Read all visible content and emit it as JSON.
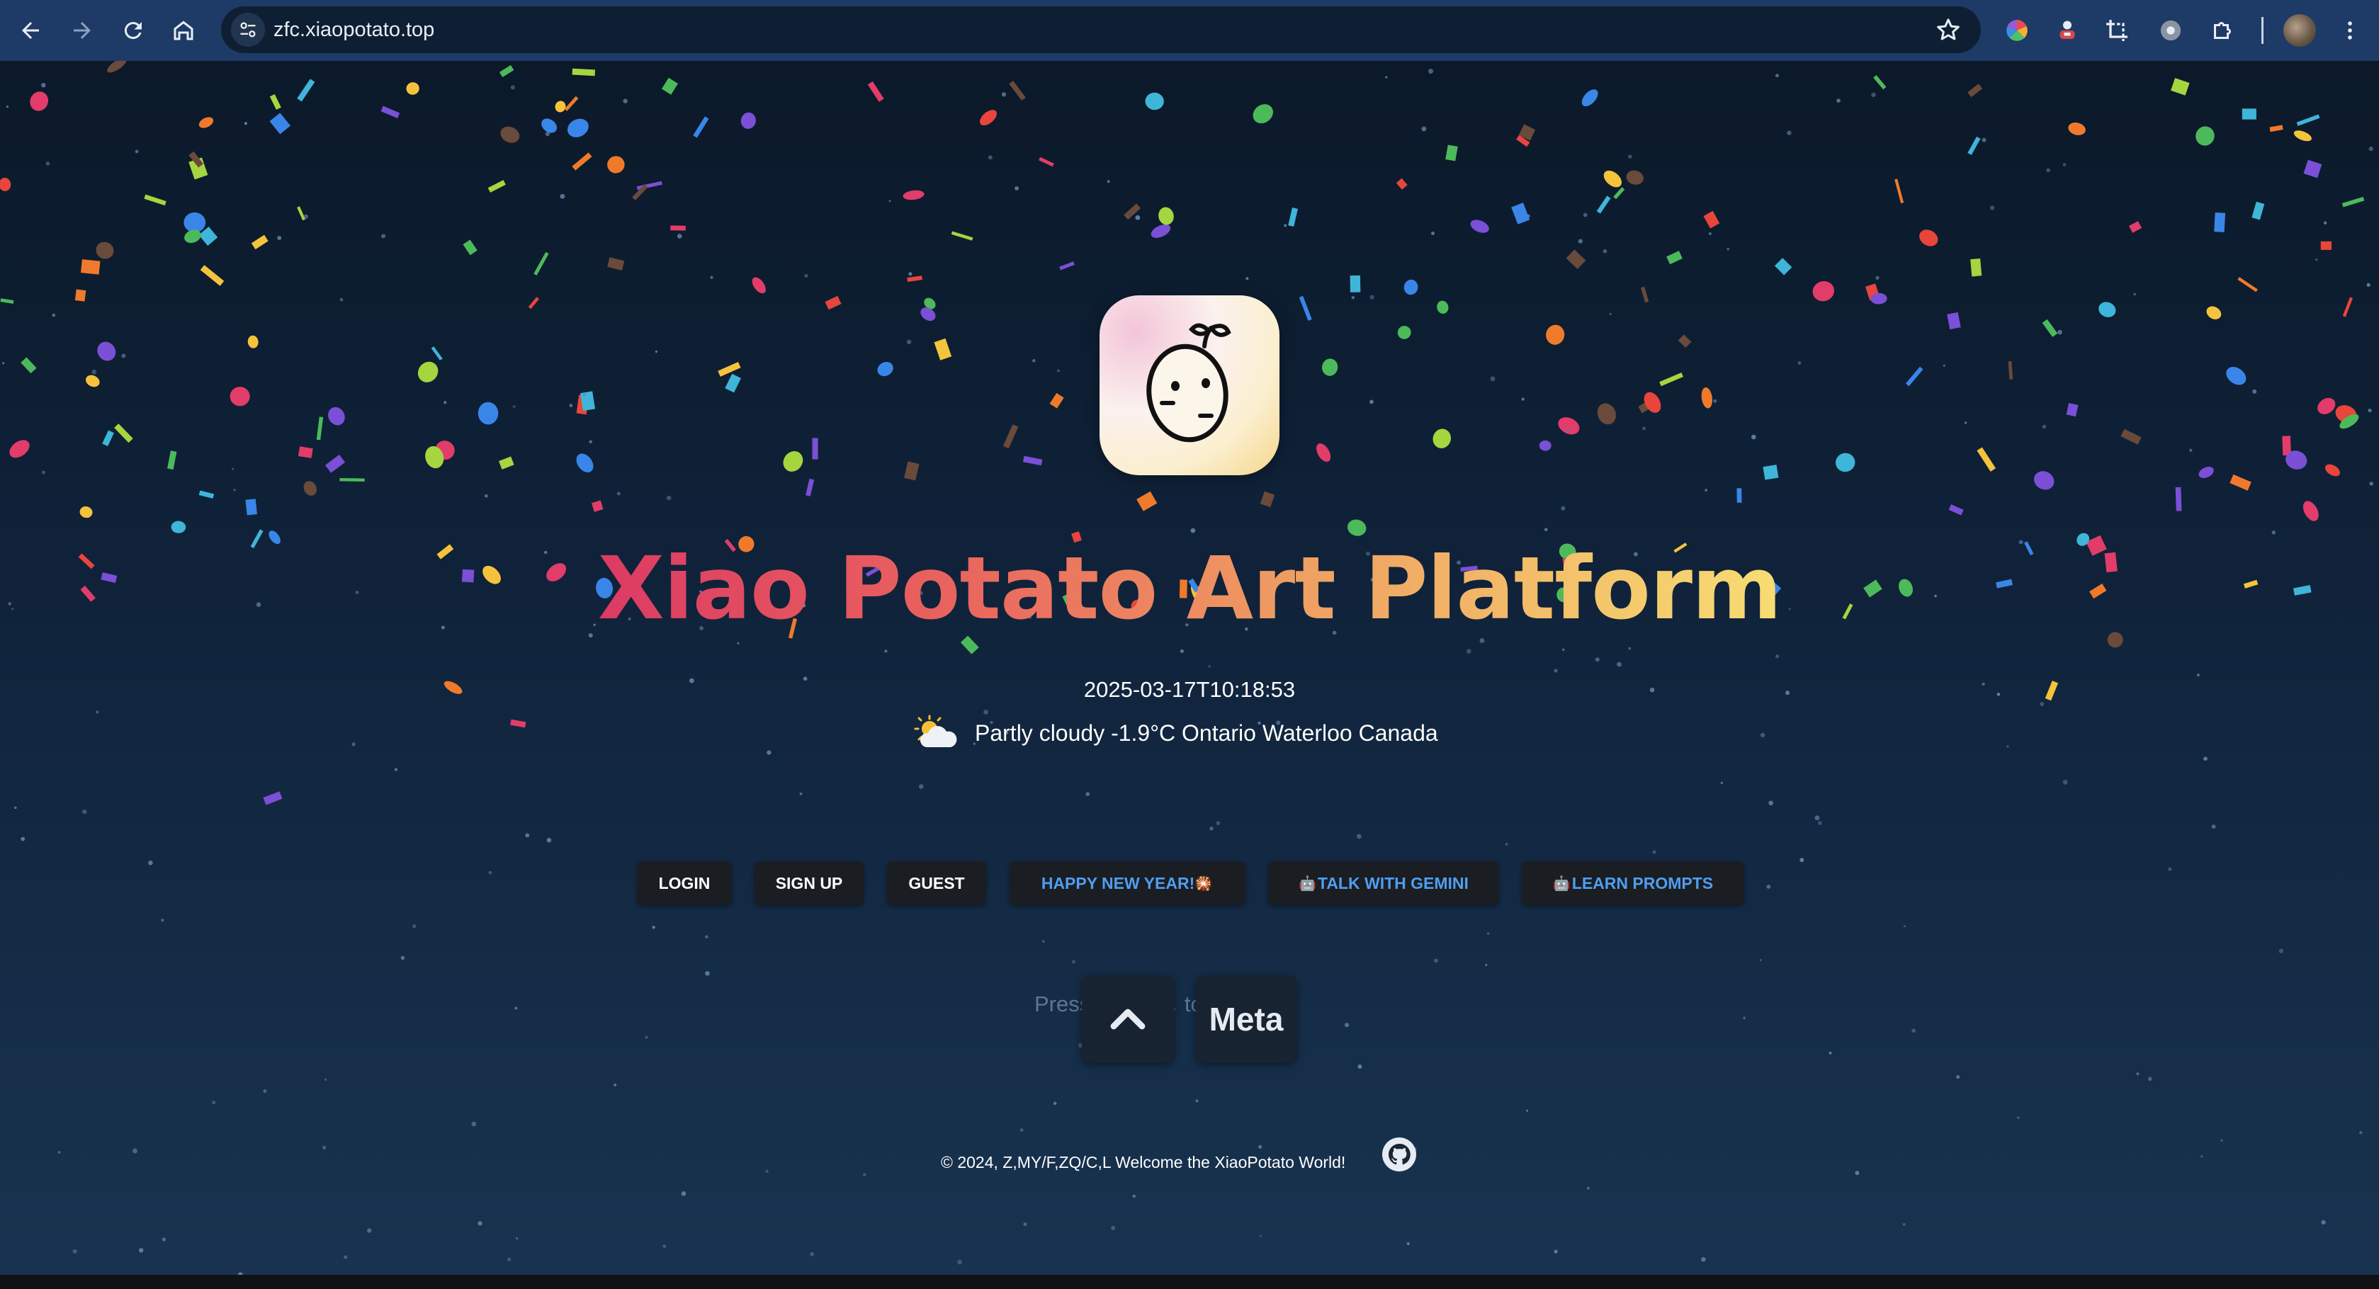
{
  "browser": {
    "url": "zfc.xiaopotato.top",
    "back_icon": "arrow-left-icon",
    "forward_icon": "arrow-right-icon",
    "reload_icon": "reload-icon",
    "home_icon": "home-icon",
    "site_info_icon": "tune-icon",
    "bookmark_icon": "star-icon",
    "extensions": [
      "color-wheel-icon",
      "agent-icon",
      "crop-icon",
      "gear-badge-icon",
      "puzzle-icon"
    ],
    "menu_icon": "kebab-menu-icon"
  },
  "hero": {
    "title": "Xiao Potato Art Platform",
    "datetime": "2025-03-17T10:18:53",
    "weather_icon": "partly-cloudy-icon",
    "weather": "Partly cloudy -1.9°C Ontario Waterloo Canada"
  },
  "buttons": {
    "login": "LOGIN",
    "signup": "SIGN UP",
    "guest": "GUEST",
    "new_year": "HAPPY NEW YEAR!",
    "new_year_emoji": "🎇",
    "gemini": "TALK WITH GEMINI",
    "gemini_emoji": "🤖",
    "prompts": "LEARN PROMPTS",
    "prompts_emoji": "🤖"
  },
  "hint": {
    "text": "Press ⌘ ↑ or ↓ to pause",
    "key_up_icon": "chevron-up-icon",
    "key_meta": "Meta"
  },
  "footer": {
    "text": "© 2024, Z,MY/F,ZQ/C,L Welcome the XiaoPotato World!",
    "github_icon": "github-icon"
  },
  "colors": {
    "toolbar": "#1e3a66",
    "page_top": "#0b1929",
    "page_bottom": "#183350",
    "button_bg": "#1a1d22",
    "button_blue_text": "#4f9ef0",
    "title_start": "#dc3a63",
    "title_end": "#f7dd72"
  }
}
